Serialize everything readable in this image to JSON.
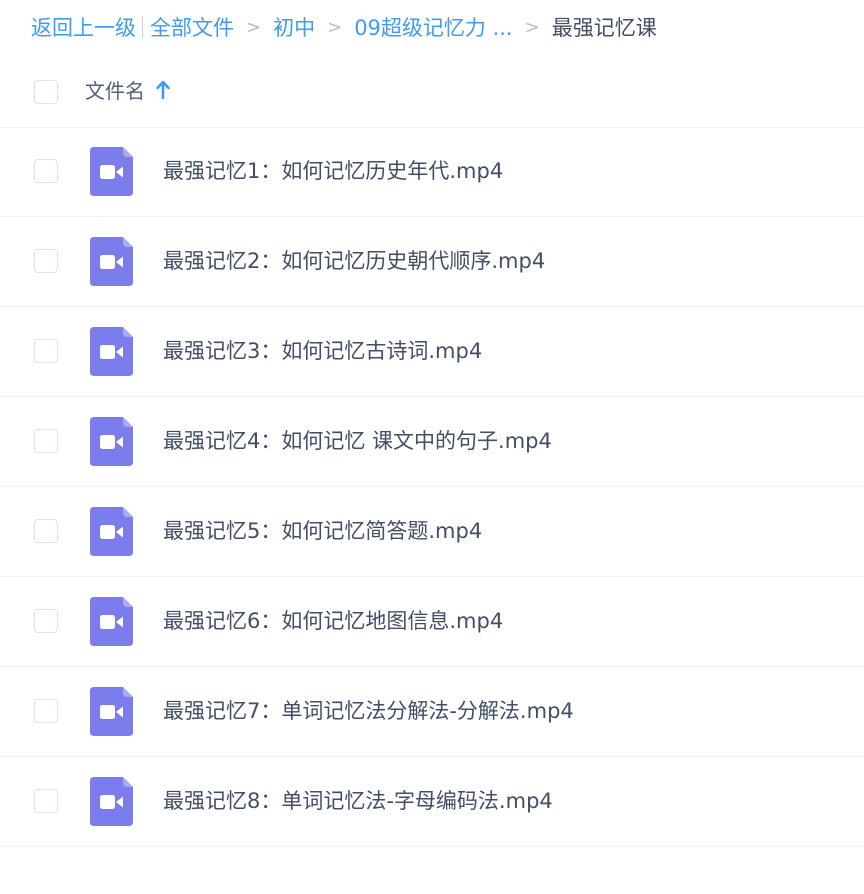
{
  "breadcrumb": {
    "back": "返回上一级",
    "items": [
      "全部文件",
      "初中",
      "09超级记忆力 ..."
    ],
    "separator": ">",
    "current": "最强记忆课"
  },
  "header": {
    "column_label": "文件名",
    "sort_icon": "arrow-up-icon"
  },
  "files": [
    {
      "name": "最强记忆1：如何记忆历史年代.mp4",
      "icon": "video-file-icon"
    },
    {
      "name": "最强记忆2：如何记忆历史朝代顺序.mp4",
      "icon": "video-file-icon"
    },
    {
      "name": "最强记忆3：如何记忆古诗词.mp4",
      "icon": "video-file-icon"
    },
    {
      "name": "最强记忆4：如何记忆 课文中的句子.mp4",
      "icon": "video-file-icon"
    },
    {
      "name": "最强记忆5：如何记忆简答题.mp4",
      "icon": "video-file-icon"
    },
    {
      "name": "最强记忆6：如何记忆地图信息.mp4",
      "icon": "video-file-icon"
    },
    {
      "name": "最强记忆7：单词记忆法分解法-分解法.mp4",
      "icon": "video-file-icon"
    },
    {
      "name": "最强记忆8：单词记忆法-字母编码法.mp4",
      "icon": "video-file-icon"
    }
  ],
  "colors": {
    "link": "#3e9bf6",
    "text": "#424e67",
    "video_icon": "#7c7dec",
    "divider": "#f0f2f6"
  }
}
